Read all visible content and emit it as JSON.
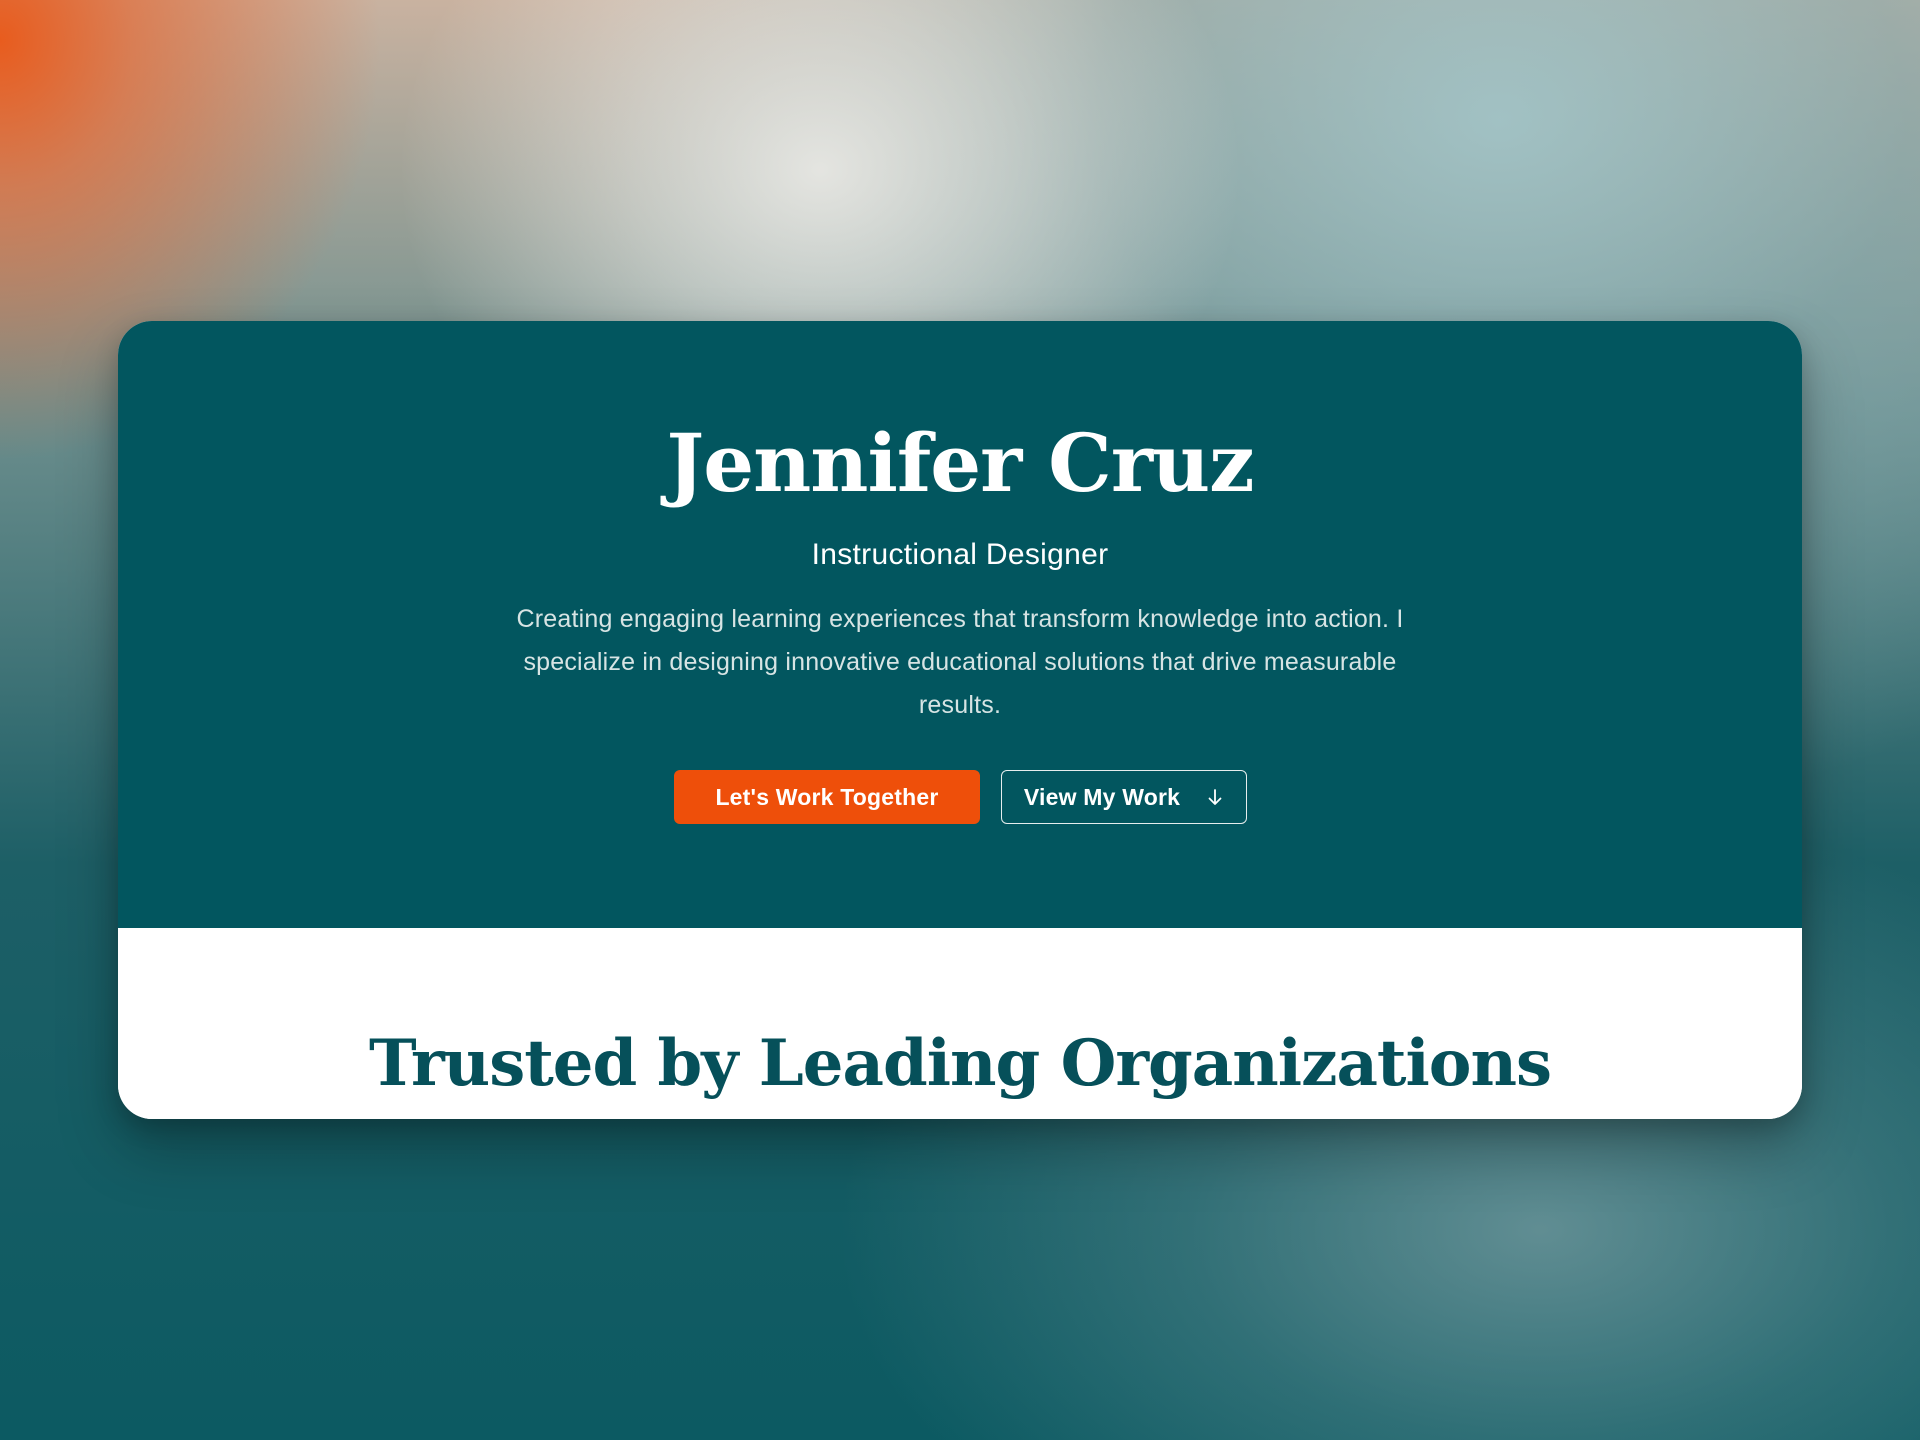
{
  "hero": {
    "name": "Jennifer Cruz",
    "title": "Instructional Designer",
    "description": "Creating engaging learning experiences that transform knowledge into action. I specialize in designing innovative educational solutions that drive measurable results.",
    "primary_button": "Let's Work Together",
    "secondary_button": "View My Work",
    "secondary_icon": "arrow-down-icon"
  },
  "clients": {
    "heading": "Trusted by Leading Organizations"
  },
  "colors": {
    "hero_background": "#02565f",
    "accent": "#ee4f0a",
    "heading_dark": "#06505a"
  }
}
